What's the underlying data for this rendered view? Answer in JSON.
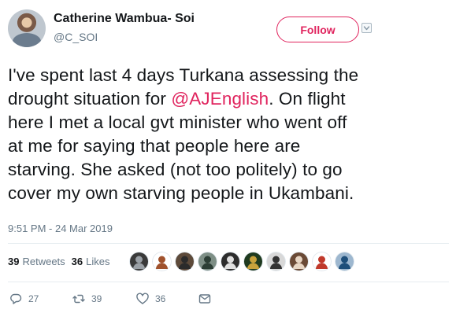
{
  "author": {
    "display_name": "Catherine Wambua- Soi",
    "handle": "@C_SOI"
  },
  "follow_label": "Follow",
  "tweet": {
    "lines": [
      {
        "before": "I've spent last 4 days Turkana assessing the",
        "mention": "",
        "after": ""
      },
      {
        "before": "drought situation for ",
        "mention": "@AJEnglish",
        "after": ". On flight"
      },
      {
        "before": "here I met a local gvt minister who went off",
        "mention": "",
        "after": ""
      },
      {
        "before": "at me for saying that people here are",
        "mention": "",
        "after": ""
      },
      {
        "before": "starving. She asked (not too politely) to go",
        "mention": "",
        "after": ""
      },
      {
        "before": "cover my own starving people in Ukambani.",
        "mention": "",
        "after": ""
      }
    ],
    "timestamp": "9:51 PM - 24 Mar 2019"
  },
  "stats": {
    "retweets_count": "39",
    "retweets_label": "Retweets",
    "likes_count": "36",
    "likes_label": "Likes"
  },
  "likers": [
    {
      "name": "liker-avatar-1",
      "color": "#3a3a3a",
      "accent": "#9aa0a6"
    },
    {
      "name": "liker-avatar-2",
      "color": "#ffffff",
      "accent": "#a0522d"
    },
    {
      "name": "liker-avatar-3",
      "color": "#5d4a3a",
      "accent": "#2b2b2b"
    },
    {
      "name": "liker-avatar-4",
      "color": "#7e8f86",
      "accent": "#2c3e35"
    },
    {
      "name": "liker-avatar-5",
      "color": "#2d2d2d",
      "accent": "#e0e0e0"
    },
    {
      "name": "liker-avatar-6",
      "color": "#1f3a1f",
      "accent": "#c8a23c"
    },
    {
      "name": "liker-avatar-7",
      "color": "#d8d8d8",
      "accent": "#333333"
    },
    {
      "name": "liker-avatar-8",
      "color": "#6b4a36",
      "accent": "#e8d6c4"
    },
    {
      "name": "liker-avatar-9",
      "color": "#ffffff",
      "accent": "#c0392b"
    },
    {
      "name": "liker-avatar-10",
      "color": "#9db7cf",
      "accent": "#1e4f7a"
    }
  ],
  "actions": {
    "reply_count": "27",
    "retweet_count": "39",
    "like_count": "36"
  },
  "colors": {
    "accent": "#e0245e",
    "secondary_text": "#657786"
  },
  "icons": {
    "more": "caret-down-icon",
    "reply": "reply-icon",
    "retweet": "retweet-icon",
    "like": "heart-icon",
    "dm": "envelope-icon"
  }
}
